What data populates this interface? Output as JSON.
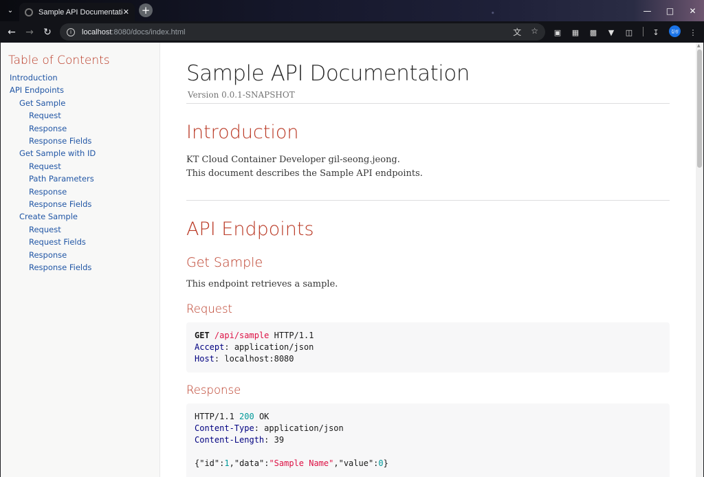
{
  "browser": {
    "tab_title": "Sample API Documentation",
    "url_host": "localhost",
    "url_rest": ":8080/docs/index.html",
    "accent": "#1a73e8",
    "profile_label": "길성"
  },
  "toc": {
    "title": "Table of Contents",
    "items": [
      {
        "label": "Introduction",
        "level": 1
      },
      {
        "label": "API Endpoints",
        "level": 1
      },
      {
        "label": "Get Sample",
        "level": 2
      },
      {
        "label": "Request",
        "level": 3
      },
      {
        "label": "Response",
        "level": 3
      },
      {
        "label": "Response Fields",
        "level": 3
      },
      {
        "label": "Get Sample with ID",
        "level": 2
      },
      {
        "label": "Request",
        "level": 3
      },
      {
        "label": "Path Parameters",
        "level": 3
      },
      {
        "label": "Response",
        "level": 3
      },
      {
        "label": "Response Fields",
        "level": 3
      },
      {
        "label": "Create Sample",
        "level": 2
      },
      {
        "label": "Request",
        "level": 3
      },
      {
        "label": "Request Fields",
        "level": 3
      },
      {
        "label": "Response",
        "level": 3
      },
      {
        "label": "Response Fields",
        "level": 3
      }
    ]
  },
  "doc": {
    "title": "Sample API Documentation",
    "version": "Version 0.0.1-SNAPSHOT",
    "intro_heading": "Introduction",
    "intro_line1": "KT Cloud Container Developer gil-seong.jeong.",
    "intro_line2": "This document describes the Sample API endpoints.",
    "endpoints_heading": "API Endpoints",
    "get_sample_heading": "Get Sample",
    "get_sample_desc": "This endpoint retrieves a sample.",
    "request_heading": "Request",
    "response_heading": "Response",
    "request_code": {
      "method": "GET",
      "path": "/api/sample",
      "proto": "HTTP/1.1",
      "h1_name": "Accept",
      "h1_value": "application/json",
      "h2_name": "Host",
      "h2_value": "localhost:8080"
    },
    "response_code": {
      "proto": "HTTP/1.1",
      "status": "200",
      "reason": "OK",
      "h1_name": "Content-Type",
      "h1_value": "application/json",
      "h2_name": "Content-Length",
      "h2_value": "39",
      "body_id_key": "\"id\"",
      "body_id_val": "1",
      "body_data_key": "\"data\"",
      "body_data_val": "\"Sample Name\"",
      "body_value_key": "\"value\"",
      "body_value_val": "0"
    }
  }
}
